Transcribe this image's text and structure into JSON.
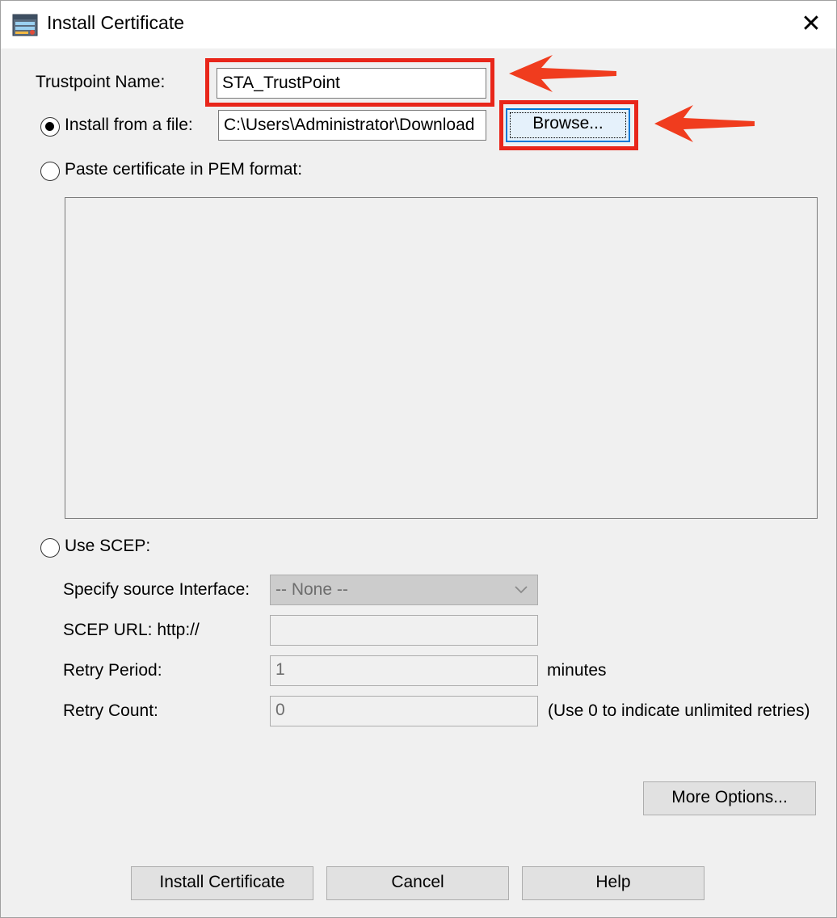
{
  "window": {
    "title": "Install Certificate",
    "icon": "certificate-app-icon",
    "close_glyph": "✕"
  },
  "trustpoint": {
    "label": "Trustpoint Name:",
    "value": "STA_TrustPoint"
  },
  "install_file": {
    "label": "Install from a file:",
    "selected": true,
    "path_value": "C:\\Users\\Administrator\\Download",
    "browse_label": "Browse..."
  },
  "paste_pem": {
    "label": "Paste certificate in PEM format:",
    "selected": false,
    "value": ""
  },
  "scep": {
    "label": "Use SCEP:",
    "selected": false,
    "source_interface_label": "Specify source Interface:",
    "source_interface_value": "-- None --",
    "url_label": "SCEP URL: http://",
    "url_value": "",
    "retry_period_label": "Retry Period:",
    "retry_period_value": "1",
    "retry_period_unit": "minutes",
    "retry_count_label": "Retry Count:",
    "retry_count_value": "0",
    "retry_count_hint": "(Use 0 to indicate unlimited retries)"
  },
  "buttons": {
    "more_options": "More Options...",
    "install": "Install Certificate",
    "cancel": "Cancel",
    "help": "Help"
  },
  "annotations": {
    "highlight_color": "#e8261a",
    "arrow_color": "#f03c1e"
  }
}
